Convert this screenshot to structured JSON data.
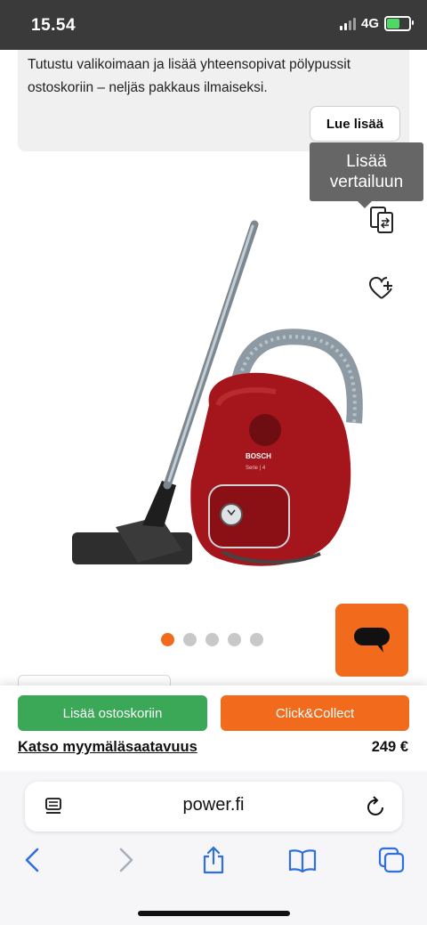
{
  "status_bar": {
    "time": "15.54",
    "network": "4G"
  },
  "banner": {
    "text": "Tutustu valikoimaan ja lisää yhteensopivat pölypussit ostoskoriin – neljäs pakkaus ilmaiseksi.",
    "button_label": "Lue lisää"
  },
  "tooltip": {
    "text": "Lisää vertailuun"
  },
  "product": {
    "brand_on_image": "BOSCH",
    "series_on_image": "Serie | 4"
  },
  "carousel": {
    "count": 5,
    "active_index": 0
  },
  "actions": {
    "add_to_cart_label": "Lisää ostoskoriin",
    "click_collect_label": "Click&Collect",
    "store_availability_label": "Katso myymäläsaatavuus",
    "price": "249 €"
  },
  "browser": {
    "url": "power.fi"
  },
  "colors": {
    "accent_orange": "#f26b1d",
    "cart_green": "#3aa857",
    "status_bar_bg": "#3a3a3a",
    "product_red": "#a4161b"
  },
  "icons": [
    "compare-icon",
    "wishlist-heart-icon",
    "chat-icon",
    "reader-icon",
    "reload-icon",
    "back-icon",
    "forward-icon",
    "share-icon",
    "bookmarks-icon",
    "tabs-icon"
  ]
}
